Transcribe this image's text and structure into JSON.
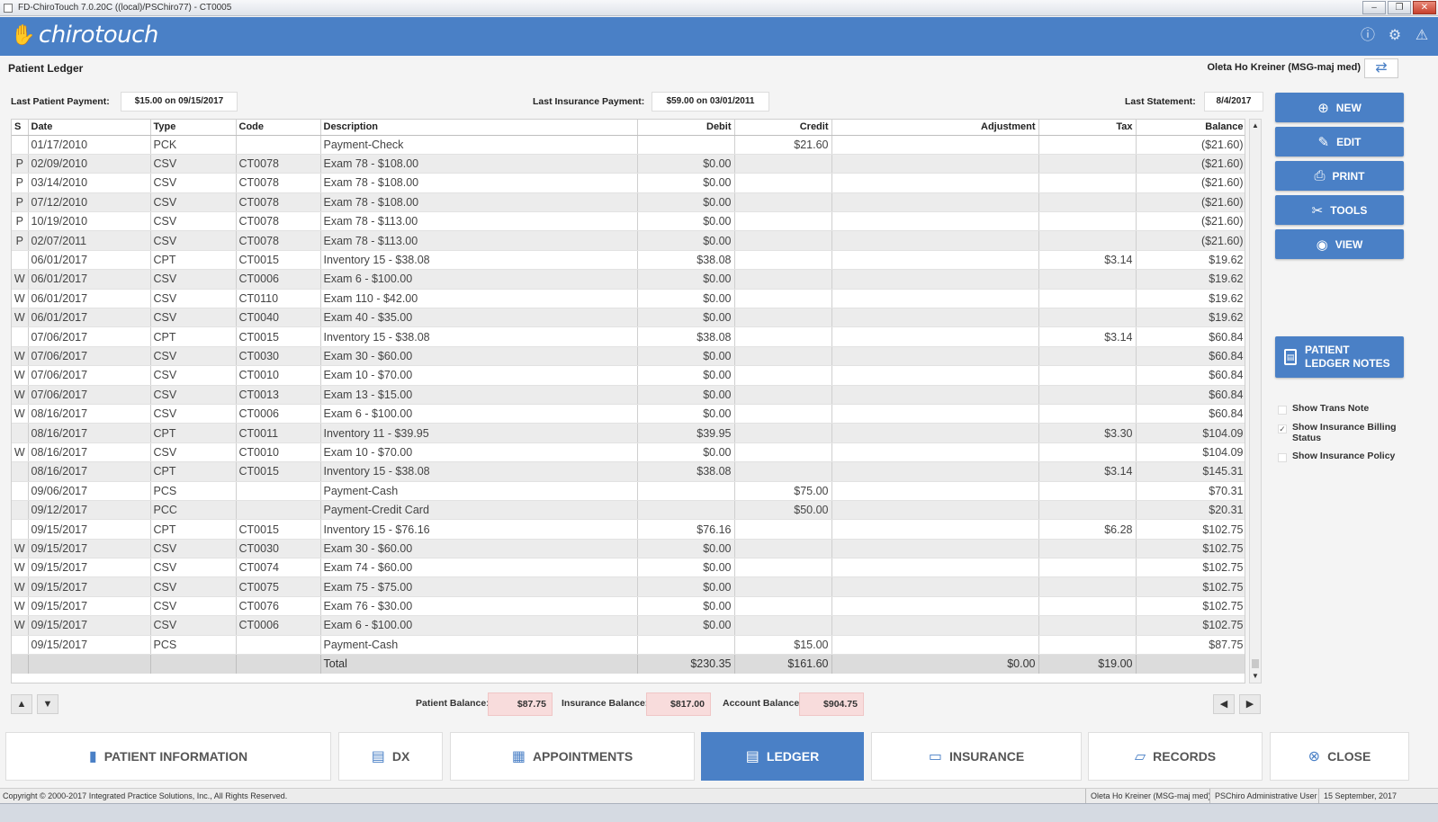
{
  "window": {
    "title": "FD-ChiroTouch 7.0.20C ((local)/PSChiro77) - CT0005",
    "minimize": "–",
    "maximize": "❐",
    "close": "✕"
  },
  "brand": {
    "logo_text": "chirotouch"
  },
  "header": {
    "page_title": "Patient Ledger",
    "patient_name": "Oleta Ho Kreiner (MSG-maj med)"
  },
  "info": {
    "last_patient_payment_label": "Last Patient Payment:",
    "last_patient_payment": "$15.00 on 09/15/2017",
    "last_insurance_payment_label": "Last Insurance Payment:",
    "last_insurance_payment": "$59.00 on 03/01/2011",
    "last_statement_label": "Last Statement:",
    "last_statement": "8/4/2017"
  },
  "table": {
    "columns": [
      "S",
      "Date",
      "Type",
      "Code",
      "Description",
      "Debit",
      "Credit",
      "Adjustment",
      "Tax",
      "Balance"
    ],
    "rows": [
      [
        "",
        "01/17/2010",
        "PCK",
        "",
        "Payment-Check",
        "",
        "$21.60",
        "",
        "",
        "($21.60)"
      ],
      [
        "P",
        "02/09/2010",
        "CSV",
        "CT0078",
        "Exam 78 - $108.00",
        "$0.00",
        "",
        "",
        "",
        "($21.60)"
      ],
      [
        "P",
        "03/14/2010",
        "CSV",
        "CT0078",
        "Exam 78 - $108.00",
        "$0.00",
        "",
        "",
        "",
        "($21.60)"
      ],
      [
        "P",
        "07/12/2010",
        "CSV",
        "CT0078",
        "Exam 78 - $108.00",
        "$0.00",
        "",
        "",
        "",
        "($21.60)"
      ],
      [
        "P",
        "10/19/2010",
        "CSV",
        "CT0078",
        "Exam 78 - $113.00",
        "$0.00",
        "",
        "",
        "",
        "($21.60)"
      ],
      [
        "P",
        "02/07/2011",
        "CSV",
        "CT0078",
        "Exam 78 - $113.00",
        "$0.00",
        "",
        "",
        "",
        "($21.60)"
      ],
      [
        "",
        "06/01/2017",
        "CPT",
        "CT0015",
        "Inventory 15 - $38.08",
        "$38.08",
        "",
        "",
        "$3.14",
        "$19.62"
      ],
      [
        "W",
        "06/01/2017",
        "CSV",
        "CT0006",
        "Exam 6 - $100.00",
        "$0.00",
        "",
        "",
        "",
        "$19.62"
      ],
      [
        "W",
        "06/01/2017",
        "CSV",
        "CT0110",
        "Exam 110 - $42.00",
        "$0.00",
        "",
        "",
        "",
        "$19.62"
      ],
      [
        "W",
        "06/01/2017",
        "CSV",
        "CT0040",
        "Exam 40 - $35.00",
        "$0.00",
        "",
        "",
        "",
        "$19.62"
      ],
      [
        "",
        "07/06/2017",
        "CPT",
        "CT0015",
        "Inventory 15 - $38.08",
        "$38.08",
        "",
        "",
        "$3.14",
        "$60.84"
      ],
      [
        "W",
        "07/06/2017",
        "CSV",
        "CT0030",
        "Exam 30 - $60.00",
        "$0.00",
        "",
        "",
        "",
        "$60.84"
      ],
      [
        "W",
        "07/06/2017",
        "CSV",
        "CT0010",
        "Exam 10 - $70.00",
        "$0.00",
        "",
        "",
        "",
        "$60.84"
      ],
      [
        "W",
        "07/06/2017",
        "CSV",
        "CT0013",
        "Exam 13 - $15.00",
        "$0.00",
        "",
        "",
        "",
        "$60.84"
      ],
      [
        "W",
        "08/16/2017",
        "CSV",
        "CT0006",
        "Exam 6 - $100.00",
        "$0.00",
        "",
        "",
        "",
        "$60.84"
      ],
      [
        "",
        "08/16/2017",
        "CPT",
        "CT0011",
        "Inventory 11 - $39.95",
        "$39.95",
        "",
        "",
        "$3.30",
        "$104.09"
      ],
      [
        "W",
        "08/16/2017",
        "CSV",
        "CT0010",
        "Exam 10 - $70.00",
        "$0.00",
        "",
        "",
        "",
        "$104.09"
      ],
      [
        "",
        "08/16/2017",
        "CPT",
        "CT0015",
        "Inventory 15 - $38.08",
        "$38.08",
        "",
        "",
        "$3.14",
        "$145.31"
      ],
      [
        "",
        "09/06/2017",
        "PCS",
        "",
        "Payment-Cash",
        "",
        "$75.00",
        "",
        "",
        "$70.31"
      ],
      [
        "",
        "09/12/2017",
        "PCC",
        "",
        "Payment-Credit Card",
        "",
        "$50.00",
        "",
        "",
        "$20.31"
      ],
      [
        "",
        "09/15/2017",
        "CPT",
        "CT0015",
        "Inventory 15 - $76.16",
        "$76.16",
        "",
        "",
        "$6.28",
        "$102.75"
      ],
      [
        "W",
        "09/15/2017",
        "CSV",
        "CT0030",
        "Exam 30 - $60.00",
        "$0.00",
        "",
        "",
        "",
        "$102.75"
      ],
      [
        "W",
        "09/15/2017",
        "CSV",
        "CT0074",
        "Exam 74 - $60.00",
        "$0.00",
        "",
        "",
        "",
        "$102.75"
      ],
      [
        "W",
        "09/15/2017",
        "CSV",
        "CT0075",
        "Exam 75 - $75.00",
        "$0.00",
        "",
        "",
        "",
        "$102.75"
      ],
      [
        "W",
        "09/15/2017",
        "CSV",
        "CT0076",
        "Exam 76 - $30.00",
        "$0.00",
        "",
        "",
        "",
        "$102.75"
      ],
      [
        "W",
        "09/15/2017",
        "CSV",
        "CT0006",
        "Exam 6 - $100.00",
        "$0.00",
        "",
        "",
        "",
        "$102.75"
      ],
      [
        "",
        "09/15/2017",
        "PCS",
        "",
        "Payment-Cash",
        "",
        "$15.00",
        "",
        "",
        "$87.75"
      ]
    ],
    "total": [
      "",
      "",
      "",
      "",
      "Total",
      "$230.35",
      "$161.60",
      "$0.00",
      "$19.00",
      ""
    ]
  },
  "actions": [
    {
      "label": "NEW",
      "icon": "⊕",
      "name": "new-button"
    },
    {
      "label": "EDIT",
      "icon": "✎",
      "name": "edit-button"
    },
    {
      "label": "PRINT",
      "icon": "⎙",
      "name": "print-button"
    },
    {
      "label": "TOOLS",
      "icon": "✂",
      "name": "tools-button"
    },
    {
      "label": "VIEW",
      "icon": "◉",
      "name": "view-button"
    }
  ],
  "notes_button": {
    "line1": "PATIENT",
    "line2": "LEDGER NOTES"
  },
  "options": [
    {
      "label": "Show Trans Note",
      "checked": false
    },
    {
      "label": "Show Insurance Billing Status",
      "checked": true
    },
    {
      "label": "Show Insurance Policy",
      "checked": false
    }
  ],
  "balances": {
    "patient_label": "Patient Balance:",
    "patient": "$87.75",
    "insurance_label": "Insurance Balance:",
    "insurance": "$817.00",
    "account_label": "Account Balance:",
    "account": "$904.75"
  },
  "tabs": [
    {
      "label": "PATIENT INFORMATION",
      "icon": "▮",
      "name": "tab-patient-information",
      "active": false
    },
    {
      "label": "DX",
      "icon": "▤",
      "name": "tab-dx",
      "active": false
    },
    {
      "label": "APPOINTMENTS",
      "icon": "▦",
      "name": "tab-appointments",
      "active": false
    },
    {
      "label": "LEDGER",
      "icon": "▤",
      "name": "tab-ledger",
      "active": true
    },
    {
      "label": "INSURANCE",
      "icon": "▭",
      "name": "tab-insurance",
      "active": false
    },
    {
      "label": "RECORDS",
      "icon": "▱",
      "name": "tab-records",
      "active": false
    },
    {
      "label": "CLOSE",
      "icon": "⊗",
      "name": "tab-close",
      "active": false
    }
  ],
  "status": {
    "copyright": "Copyright © 2000-2017 Integrated Practice Solutions, Inc., All Rights Reserved.",
    "patient": "Oleta Ho Kreiner (MSG-maj med)",
    "user": "PSChiro Administrative User",
    "date": "15 September, 2017"
  },
  "colors": {
    "accent": "#4a80c6",
    "balance_bg": "#f8dcdc"
  }
}
